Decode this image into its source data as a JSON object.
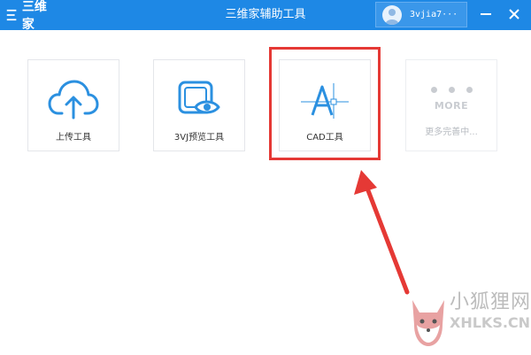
{
  "titlebar": {
    "logo_text": "三维家",
    "title": "三维家辅助工具",
    "username": "3vjia7···"
  },
  "tools": [
    {
      "label": "上传工具",
      "icon": "cloud-upload-icon"
    },
    {
      "label": "3VJ预览工具",
      "icon": "preview-eye-icon"
    },
    {
      "label": "CAD工具",
      "icon": "cad-icon"
    },
    {
      "label": "更多完善中...",
      "icon": "more-icon",
      "more_word": "MORE"
    }
  ],
  "watermark": {
    "cn": "小狐狸网",
    "en": "XHLKS.CN"
  },
  "colors": {
    "accent": "#1e88e5",
    "icon_blue": "#2b90e0",
    "highlight": "#e53935"
  }
}
